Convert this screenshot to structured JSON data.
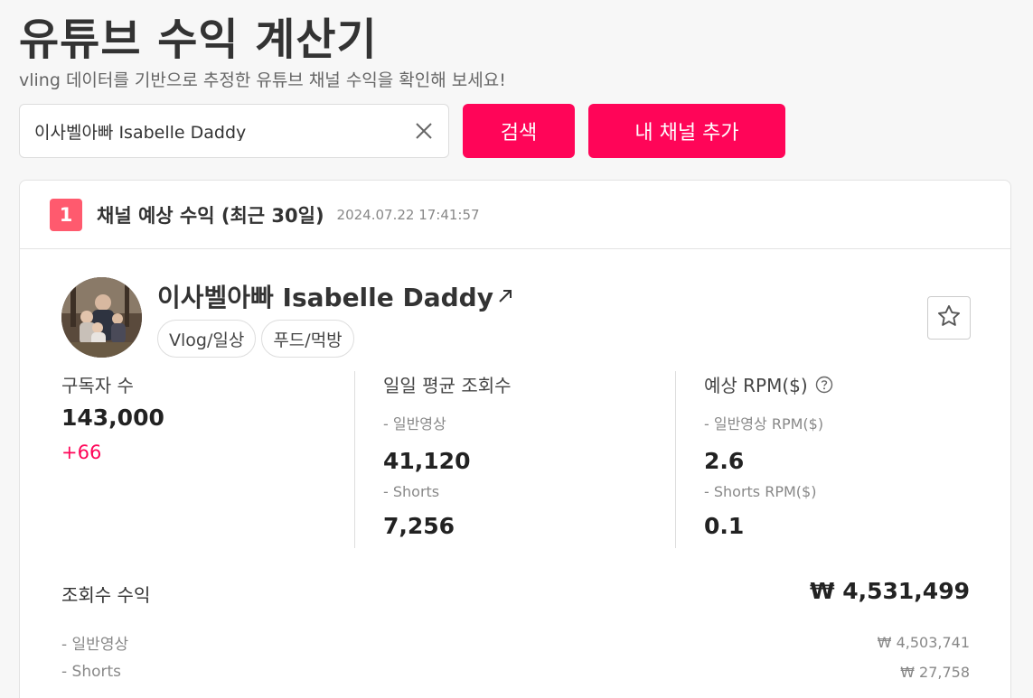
{
  "page": {
    "title": "유튜브 수익 계산기",
    "subtitle": "vling 데이터를 기반으로 추정한 유튜브 채널 수익을 확인해 보세요!"
  },
  "search": {
    "value": "이사벨아빠 Isabelle Daddy",
    "clear_icon": "close-icon"
  },
  "buttons": {
    "search_label": "검색",
    "add_channel_label": "내 채널 추가"
  },
  "card": {
    "step": "1",
    "title": "채널 예상 수익 (최근 30일)",
    "date": "2024.07.22 17:41:57"
  },
  "channel": {
    "name": "이사벨아빠 Isabelle Daddy",
    "link_icon": "↗",
    "tags": [
      "Vlog/일상",
      "푸드/먹방"
    ],
    "favorite_icon": "star-icon"
  },
  "stats": {
    "subscribers": {
      "label": "구독자 수",
      "value": "143,000",
      "change": "+66"
    },
    "daily_views": {
      "label": "일일 평균 조회수",
      "normal_label": "- 일반영상",
      "normal_value": "41,120",
      "shorts_label": "- Shorts",
      "shorts_value": "7,256"
    },
    "rpm": {
      "label": "예상 RPM($)",
      "normal_label": "- 일반영상 RPM($)",
      "normal_value": "2.6",
      "shorts_label": "- Shorts RPM($)",
      "shorts_value": "0.1"
    }
  },
  "revenue": {
    "label": "조회수 수익",
    "total": "₩ 4,531,499",
    "normal_label": "- 일반영상",
    "normal_value": "₩ 4,503,741",
    "shorts_label": "- Shorts",
    "shorts_value": "₩ 27,758"
  },
  "colors": {
    "accent": "#ff0558",
    "badge": "#ff5a6e"
  }
}
